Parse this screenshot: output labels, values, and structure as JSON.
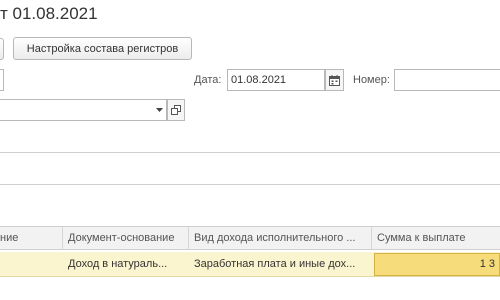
{
  "window": {
    "title": "т 01.08.2021"
  },
  "toolbar": {
    "registers_label": "Настройка состава регистров"
  },
  "form": {
    "date_label": "Дата:",
    "date_value": "01.08.2021",
    "number_label": "Номер:",
    "number_value": "",
    "select_value": ""
  },
  "table": {
    "columns": [
      "ние",
      "Документ-основание",
      "Вид дохода исполнительного ...",
      "Сумма к выплате"
    ],
    "rows": [
      {
        "col1": "",
        "document": "Доход в натураль...",
        "income_type": "Заработная плата и иные дох...",
        "amount": "1 3"
      }
    ]
  },
  "colors": {
    "row_highlight": "#fbf5cf",
    "active_cell": "#f6dc7a",
    "header_bg": "#f2f2f2"
  }
}
